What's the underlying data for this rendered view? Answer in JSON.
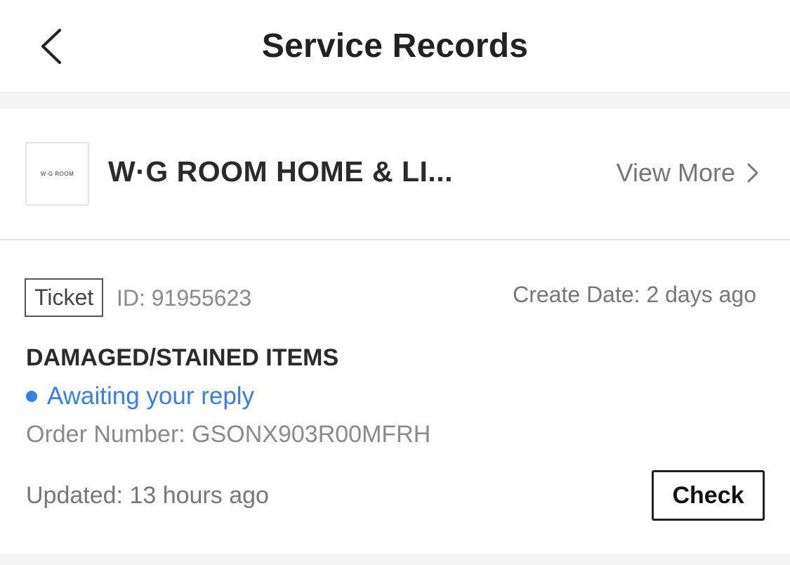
{
  "header": {
    "title": "Service Records",
    "back_icon": "chevron-left-icon"
  },
  "store": {
    "logo_text": "W·G ROOM",
    "name": "W·G ROOM HOME & LI...",
    "view_more_label": "View More",
    "view_more_icon": "chevron-right-icon"
  },
  "ticket": {
    "tag_label": "Ticket",
    "id_text": "ID: 91955623",
    "create_date": "Create Date: 2 days ago",
    "issue_title": "DAMAGED/STAINED ITEMS",
    "status": "Awaiting your reply",
    "order_number": "Order Number: GSONX903R00MFRH",
    "updated": "Updated: 13 hours ago",
    "check_label": "Check"
  },
  "colors": {
    "status_blue": "#3a7de8",
    "page_background": "#f4f4f4"
  }
}
